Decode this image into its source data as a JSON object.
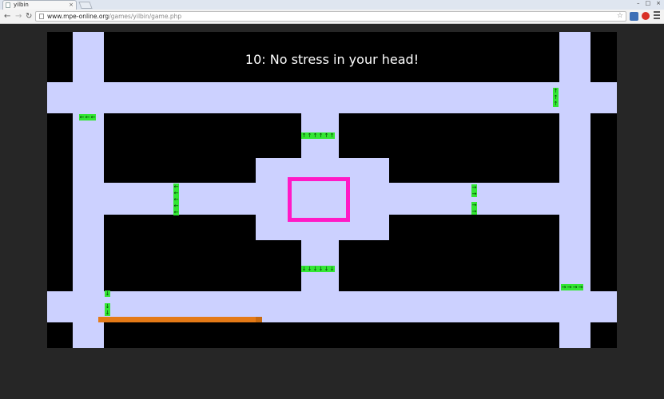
{
  "browser": {
    "tab_title": "yilbin",
    "tab_close": "×",
    "url_host": "www.mpe-online.org",
    "url_path": "/games/yilbin/game.php",
    "window_controls": [
      "–",
      "□",
      "×"
    ]
  },
  "game": {
    "level_title": "10: No stress in your head!",
    "colors": {
      "background": "#000000",
      "path": "#ccd1ff",
      "arrow_tile": "#33e633",
      "target": "#ff1ac6",
      "player": "#e47a17"
    },
    "arrow_groups": [
      {
        "name": "arrows-left-top",
        "symbols": [
          "←",
          "←",
          "←"
        ]
      },
      {
        "name": "arrows-up-top-right",
        "symbols": [
          "↑",
          "↑",
          "↑"
        ]
      },
      {
        "name": "arrows-up-center",
        "symbols": [
          "↑",
          "↑",
          "↑",
          "↑",
          "↑",
          "↑"
        ]
      },
      {
        "name": "arrows-left-middle",
        "symbols": [
          "←",
          "←",
          "←",
          "←",
          "←"
        ]
      },
      {
        "name": "arrows-right-middle-a",
        "symbols": [
          "→",
          "→"
        ]
      },
      {
        "name": "arrows-right-middle-b",
        "symbols": [
          "→",
          "→"
        ]
      },
      {
        "name": "arrows-down-center",
        "symbols": [
          "↓",
          "↓",
          "↓",
          "↓",
          "↓",
          "↓"
        ]
      },
      {
        "name": "arrows-right-bottom",
        "symbols": [
          "→",
          "→",
          "→",
          "→"
        ]
      },
      {
        "name": "arrows-down-bottom-left-a",
        "symbols": [
          "↓"
        ]
      },
      {
        "name": "arrows-down-bottom-left-b",
        "symbols": [
          "↓",
          "↓"
        ]
      }
    ]
  }
}
